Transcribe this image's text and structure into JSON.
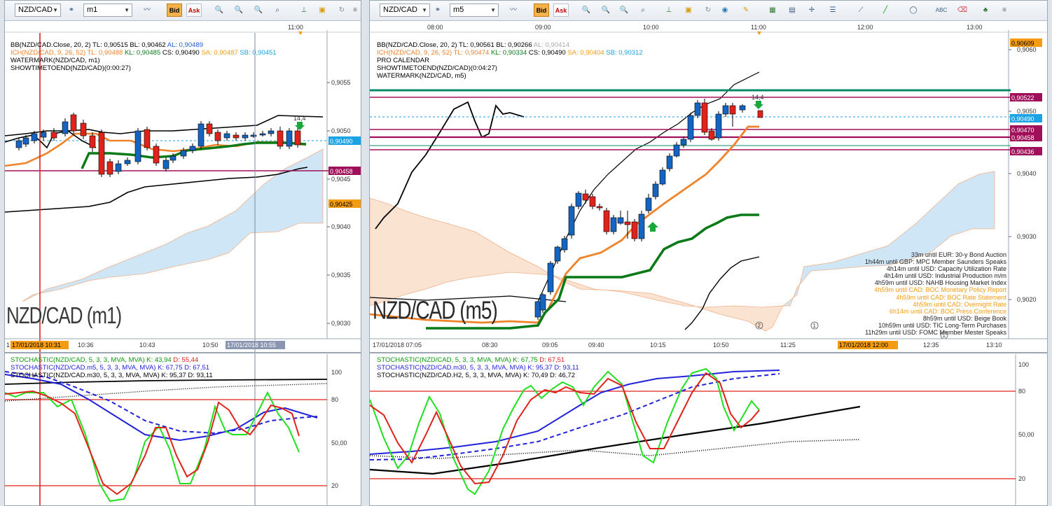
{
  "left": {
    "symbol": "NZD/CAD",
    "timeframe": "m1",
    "bid_label": "Bid",
    "ask_label": "Ask",
    "top_time": "11:00",
    "ind_bb": "BB(NZD/CAD.Close, 20, 2)  TL: 0,90515  BL: 0,90462",
    "ind_bb_al": "AL: 0,90489",
    "ind_ich": "ICH(NZD/CAD, 9, 26, 52)  TL: 0,90488",
    "ind_ich_kl": "KL: 0,90485",
    "ind_ich_cs": "CS: 0,90490",
    "ind_ich_sa": "SA: 0,90487",
    "ind_ich_sb": "SB: 0,90451",
    "ind_wm": "WATERMARK(NZD/CAD, m1)",
    "ind_stte": "SHOWTIMETOEND(NZD/CAD)(0:00:27)",
    "watermark": "NZD/CAD (m1)",
    "price_ticks": [
      "0,9055",
      "0,9050",
      "0,9045",
      "0,9040",
      "0,9035",
      "0,9030"
    ],
    "tag_current": "0,90490",
    "tag_magenta": "0,90458",
    "tag_orange": "0,90425",
    "time_ticks": [
      "10:36",
      "10:43",
      "10:50"
    ],
    "time_cursor1": "17/01/2018 10:31",
    "time_cursor2": "17/01/2018 10:55",
    "first_tick": "1",
    "value_label": "14,4",
    "stoch1": "STOCHASTIC(NZD/CAD, 5, 3, 3, MVA, MVA)  K: 43,94",
    "stoch1_d": "D: 55,44",
    "stoch2": "STOCHASTIC(NZD/CAD.m5, 5, 3, 3, MVA, MVA)  K: 67,75  D: 67,51",
    "stoch3": "STOCHASTIC(NZD/CAD.m30, 5, 3, 3, MVA, MVA)  K: 95,37  D: 93,11",
    "osc_ticks": [
      "100",
      "80",
      "50,00",
      "20"
    ]
  },
  "right": {
    "symbol": "NZD/CAD",
    "timeframe": "m5",
    "bid_label": "Bid",
    "ask_label": "Ask",
    "top_times": [
      "08:00",
      "09:00",
      "10:00",
      "11:00",
      "12:00",
      "13:00"
    ],
    "ind_bb": "BB(NZD/CAD.Close, 20, 2)  TL: 0,90561  BL: 0,90266",
    "ind_bb_al": "AL: 0,90414",
    "ind_ich": "ICH(NZD/CAD, 9, 26, 52)  TL: 0,90474",
    "ind_ich_kl": "KL: 0,90334",
    "ind_ich_cs": "CS: 0,90490",
    "ind_ich_sa": "SA: 0,90404",
    "ind_ich_sb": "SB: 0,90312",
    "ind_pc": "PRO CALENDAR",
    "ind_stte": "SHOWTIMETOEND(NZD/CAD)(0:04:27)",
    "ind_wm": "WATERMARK(NZD/CAD, m5)",
    "watermark": "NZD/CAD (m5)",
    "price_ticks": [
      "0,9060",
      "0,9050",
      "0,9040",
      "0,9030",
      "0,9020"
    ],
    "tags": [
      "0,90609",
      "0,90522",
      "0,90490",
      "0,90470",
      "0,90458",
      "0,90436"
    ],
    "time_ticks": [
      "17/01/2018 07:05",
      "08:30",
      "09:05",
      "09:40",
      "10:15",
      "10:50",
      "11:25",
      "12:35",
      "13:10"
    ],
    "time_cursor": "17/01/2018 12:00",
    "value_label": "14,4",
    "news": [
      "33m until EUR: 30-y Bond Auction",
      "1h44m until GBP: MPC Member Saunders Speaks",
      "4h14m until USD: Capacity Utilization Rate",
      "4h14m until USD: Industrial Production m/m",
      "4h59m until USD: NAHB Housing Market Index",
      "4h59m until CAD: BOC Monetary Policy Report",
      "4h59m until CAD: BOC Rate Statement",
      "4h59m until CAD: Overnight Rate",
      "6h14m until CAD: BOC Press Conference",
      "8h59m until USD: Beige Book",
      "10h59m until USD: TIC Long-Term Purchases",
      "11h29m until USD: FOMC Member Mester Speaks"
    ],
    "news_orange": [
      false,
      false,
      false,
      false,
      false,
      true,
      true,
      true,
      true,
      false,
      false,
      false
    ],
    "markers": [
      "2",
      "1",
      "1"
    ],
    "stoch1": "STOCHASTIC(NZD/CAD, 5, 3, 3, MVA, MVA)  K: 67,75",
    "stoch1_d": "D: 67,51",
    "stoch2": "STOCHASTIC(NZD/CAD.m30, 5, 3, 3, MVA, MVA)  K: 95,37  D: 93,11",
    "stoch3": "STOCHASTIC(NZD/CAD.H2, 5, 3, 3, MVA, MVA)  K: 70,49  D: 46,72",
    "osc_ticks": [
      "100",
      "80",
      "50,00",
      "20"
    ]
  },
  "colors": {
    "bull": "#1565c0",
    "bear": "#e0221a",
    "green": "#0a7a18",
    "orange": "#f0822a",
    "magenta": "#a0105a",
    "teal": "#0a8a6a",
    "cloud_blue": "#cfe6f7",
    "cloud_orange": "#fbe3d2",
    "stoch_k": "#20e020",
    "stoch_d": "#e0221a",
    "stoch_blue": "#2222dd",
    "current": "#1ba3e6",
    "tag_orange": "#f39c12"
  }
}
